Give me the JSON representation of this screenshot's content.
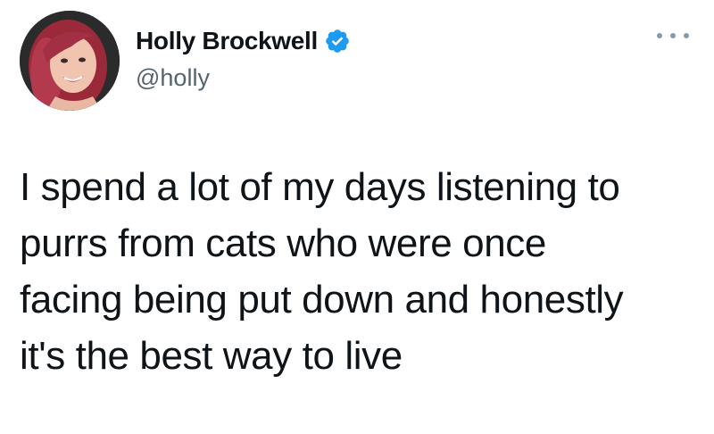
{
  "tweet": {
    "author": {
      "display_name": "Holly Brockwell",
      "handle": "@holly",
      "verified": true
    },
    "text_lines": [
      "I spend a lot of my days listening to",
      "purrs from cats who were once",
      "facing being put down and honestly",
      "it's the best way to live"
    ]
  },
  "icons": {
    "verified": "verified-badge-icon",
    "more": "more-options-icon"
  },
  "colors": {
    "text": "#0f1419",
    "secondary": "#536471",
    "verified_blue": "#1d9bf0",
    "background": "#ffffff"
  }
}
